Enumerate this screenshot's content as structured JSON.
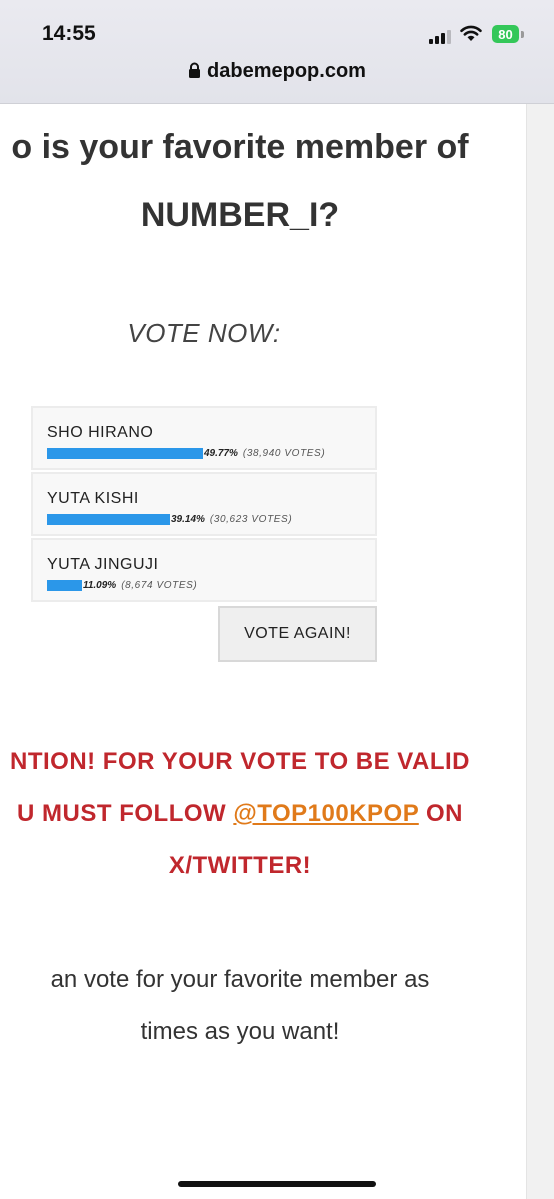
{
  "status_bar": {
    "time": "14:55",
    "battery": "80"
  },
  "browser": {
    "url": "dabemepop.com"
  },
  "page": {
    "question_line1": "o is your favorite member of",
    "question_line2": "NUMBER_I?",
    "vote_now": "VOTE NOW:",
    "poll": {
      "options": [
        {
          "name": "SHO HIRANO",
          "percent": "49.77%",
          "percent_value": 49.77,
          "votes": "(38,940 VOTES)"
        },
        {
          "name": "YUTA KISHI",
          "percent": "39.14%",
          "percent_value": 39.14,
          "votes": "(30,623 VOTES)"
        },
        {
          "name": "YUTA JINGUJI",
          "percent": "11.09%",
          "percent_value": 11.09,
          "votes": "(8,674 VOTES)"
        }
      ],
      "vote_again_label": "VOTE AGAIN!",
      "bar_color": "#2b97e9"
    },
    "attention": {
      "line1": "NTION! FOR YOUR VOTE TO BE VALID",
      "line2_prefix": "U MUST FOLLOW ",
      "line2_link": "@TOP100KPOP",
      "line2_suffix": " ON",
      "line3": "X/TWITTER!",
      "color": "#c0272d",
      "link_color": "#e07a1a"
    },
    "info_line1": "an vote for your favorite member as",
    "info_line2": "times as you want!"
  }
}
